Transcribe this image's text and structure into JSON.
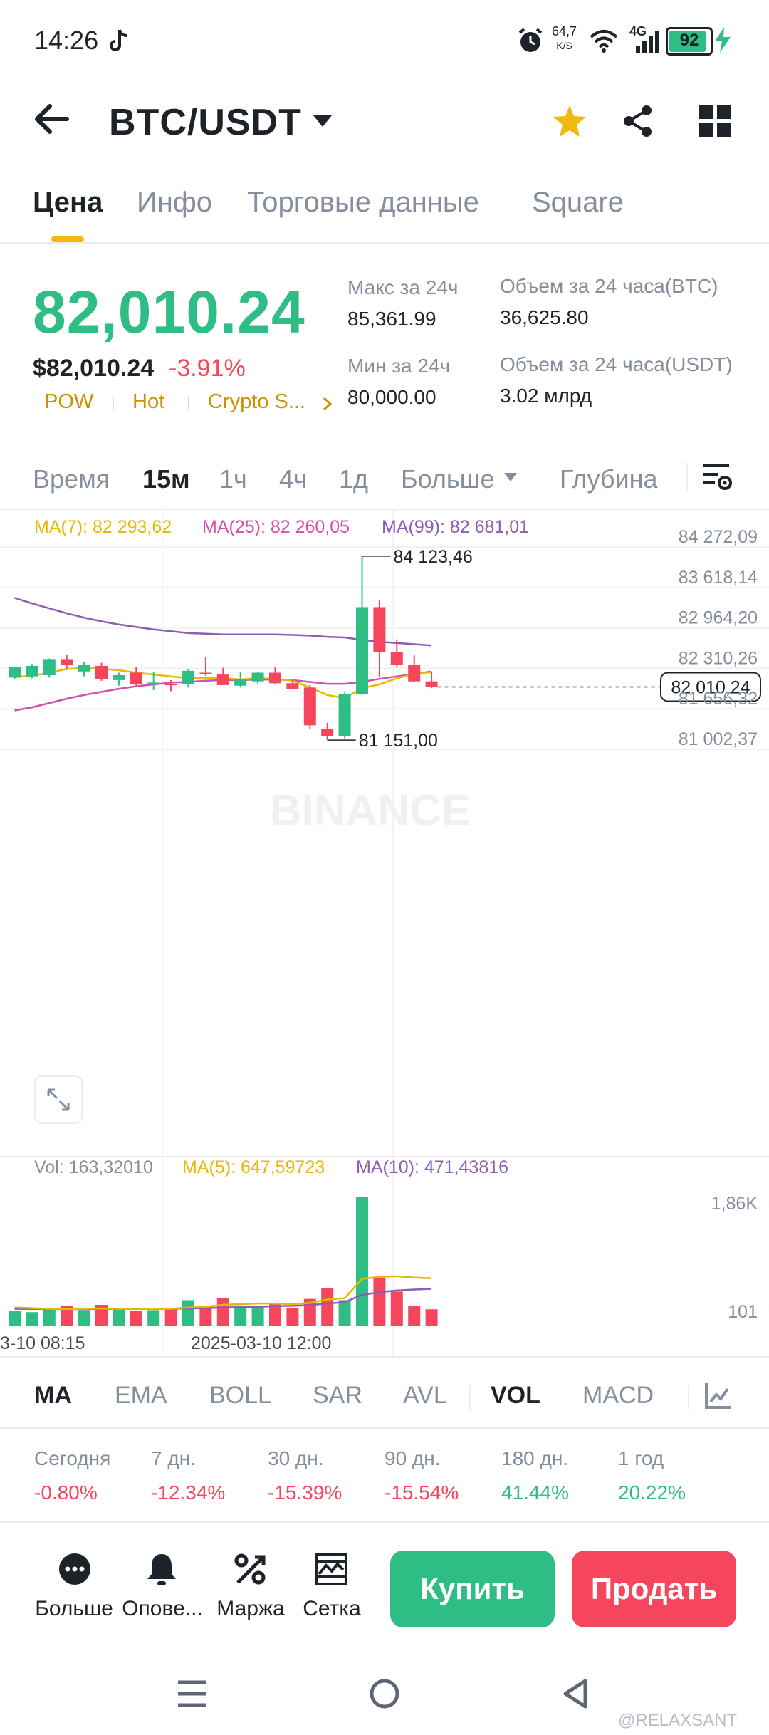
{
  "status": {
    "time": "14:26",
    "speed_value": "64,7",
    "speed_unit": "K/S",
    "network": "4G",
    "battery": "92"
  },
  "header": {
    "pair": "BTC/USDT"
  },
  "tabs": [
    "Цена",
    "Инфо",
    "Торговые данные",
    "Square"
  ],
  "price": {
    "last": "82,010.24",
    "usd": "$82,010.24",
    "change": "-3.91%",
    "tags": [
      "POW",
      "Hot",
      "Crypto S..."
    ]
  },
  "stats": {
    "high_label": "Макс за 24ч",
    "high_value": "85,361.99",
    "low_label": "Мин за 24ч",
    "low_value": "80,000.00",
    "vol_btc_label": "Объем за 24 часа(BTC)",
    "vol_btc_value": "36,625.80",
    "vol_usdt_label": "Объем за 24 часа(USDT)",
    "vol_usdt_value": "3.02 млрд"
  },
  "intervals": [
    "Время",
    "15м",
    "1ч",
    "4ч",
    "1д",
    "Больше",
    "Глубина"
  ],
  "chart_legend": {
    "ma7": "MA(7): 82 293,62",
    "ma25": "MA(25): 82 260,05",
    "ma99": "MA(99): 82 681,01"
  },
  "chart_watermark": "BINANCE",
  "chart_data": {
    "type": "candlestick",
    "price_axis": [
      "84 272,09",
      "83 618,14",
      "82 964,20",
      "82 310,26",
      "81 656,32",
      "81 002,37"
    ],
    "price_axis_values": [
      84272.09,
      83618.14,
      82964.2,
      82310.26,
      81656.32,
      81002.37
    ],
    "current_price_label": "82 010,24",
    "high_marker": "84 123,46",
    "low_marker": "81 151,00",
    "x_labels": [
      "3-10 08:15",
      "2025-03-10 12:00"
    ],
    "candles": [
      {
        "o": 82160,
        "h": 82330,
        "l": 82130,
        "c": 82330
      },
      {
        "o": 82180,
        "h": 82380,
        "l": 82150,
        "c": 82350
      },
      {
        "o": 82200,
        "h": 82470,
        "l": 82160,
        "c": 82460
      },
      {
        "o": 82460,
        "h": 82530,
        "l": 82290,
        "c": 82360
      },
      {
        "o": 82260,
        "h": 82420,
        "l": 82180,
        "c": 82370
      },
      {
        "o": 82350,
        "h": 82400,
        "l": 82110,
        "c": 82140
      },
      {
        "o": 82120,
        "h": 82240,
        "l": 82030,
        "c": 82200
      },
      {
        "o": 82240,
        "h": 82330,
        "l": 82010,
        "c": 82060
      },
      {
        "o": 82060,
        "h": 82250,
        "l": 81960,
        "c": 82080
      },
      {
        "o": 82060,
        "h": 82120,
        "l": 81940,
        "c": 82050
      },
      {
        "o": 82060,
        "h": 82300,
        "l": 82000,
        "c": 82270
      },
      {
        "o": 82240,
        "h": 82500,
        "l": 82190,
        "c": 82220
      },
      {
        "o": 82210,
        "h": 82320,
        "l": 82040,
        "c": 82040
      },
      {
        "o": 82030,
        "h": 82250,
        "l": 82000,
        "c": 82140
      },
      {
        "o": 82100,
        "h": 82250,
        "l": 82050,
        "c": 82240
      },
      {
        "o": 82240,
        "h": 82330,
        "l": 82050,
        "c": 82070
      },
      {
        "o": 82070,
        "h": 82120,
        "l": 81980,
        "c": 81980
      },
      {
        "o": 82000,
        "h": 82040,
        "l": 81330,
        "c": 81390
      },
      {
        "o": 81330,
        "h": 81430,
        "l": 81151,
        "c": 81220
      },
      {
        "o": 81220,
        "h": 81920,
        "l": 81180,
        "c": 81900
      },
      {
        "o": 81900,
        "h": 84123.46,
        "l": 81880,
        "c": 83300
      },
      {
        "o": 83300,
        "h": 83410,
        "l": 82170,
        "c": 82570
      },
      {
        "o": 82570,
        "h": 82780,
        "l": 82340,
        "c": 82370
      },
      {
        "o": 82370,
        "h": 82520,
        "l": 82080,
        "c": 82100
      },
      {
        "o": 82100,
        "h": 82260,
        "l": 81990,
        "c": 82010
      }
    ],
    "ma7": [
      82170,
      82190,
      82240,
      82300,
      82320,
      82300,
      82280,
      82240,
      82210,
      82180,
      82150,
      82160,
      82150,
      82130,
      82150,
      82140,
      82110,
      82000,
      81880,
      81830,
      81990,
      82050,
      82150,
      82220,
      82250
    ],
    "ma25": [
      81630,
      81680,
      81750,
      81820,
      81880,
      81930,
      81980,
      82020,
      82050,
      82080,
      82090,
      82110,
      82120,
      82120,
      82130,
      82130,
      82120,
      82090,
      82060,
      82060,
      82090,
      82140,
      82180,
      82220,
      82260
    ],
    "ma99": [
      83450,
      83360,
      83280,
      83200,
      83130,
      83070,
      83020,
      82980,
      82940,
      82910,
      82880,
      82870,
      82860,
      82860,
      82860,
      82860,
      82850,
      82840,
      82820,
      82810,
      82770,
      82740,
      82720,
      82700,
      82681
    ],
    "volume_legend": {
      "vol": "Vol: 163,32010",
      "ma5": "MA(5): 647,59723",
      "ma10": "MA(10): 471,43816"
    },
    "volume_axis": [
      "1,86K",
      "101"
    ],
    "volume_axis_values": [
      1860,
      101
    ],
    "volumes": [
      140,
      120,
      160,
      210,
      150,
      230,
      180,
      140,
      150,
      160,
      300,
      200,
      330,
      220,
      200,
      240,
      180,
      320,
      480,
      300,
      1860,
      640,
      430,
      220,
      163
    ],
    "vol_ma5": [
      190,
      180,
      170,
      165,
      170,
      175,
      170,
      170,
      165,
      170,
      190,
      200,
      230,
      240,
      250,
      250,
      240,
      260,
      310,
      330,
      620,
      650,
      660,
      640,
      630
    ],
    "vol_ma10": [
      170,
      168,
      166,
      165,
      165,
      168,
      170,
      168,
      168,
      170,
      175,
      180,
      190,
      195,
      200,
      210,
      215,
      225,
      250,
      270,
      380,
      420,
      445,
      460,
      471
    ]
  },
  "indicators": [
    "MA",
    "EMA",
    "BOLL",
    "SAR",
    "AVL",
    "VOL",
    "MACD"
  ],
  "performance": [
    {
      "label": "Сегодня",
      "value": "-0.80%"
    },
    {
      "label": "7 дн.",
      "value": "-12.34%"
    },
    {
      "label": "30 дн.",
      "value": "-15.39%"
    },
    {
      "label": "90 дн.",
      "value": "-15.54%"
    },
    {
      "label": "180 дн.",
      "value": "41.44%"
    },
    {
      "label": "1 год",
      "value": "20.22%"
    }
  ],
  "bottom_bar": {
    "more": "Больше",
    "alerts": "Опове...",
    "margin": "Маржа",
    "grid": "Сетка",
    "buy": "Купить",
    "sell": "Продать"
  },
  "credit": "@RELAXSANT",
  "colors": {
    "up": "#2ebd85",
    "down": "#f6465d",
    "accent": "#f0b90b",
    "ma7": "#e6b800",
    "ma25": "#d44fb0",
    "ma99": "#8a5fb3"
  }
}
